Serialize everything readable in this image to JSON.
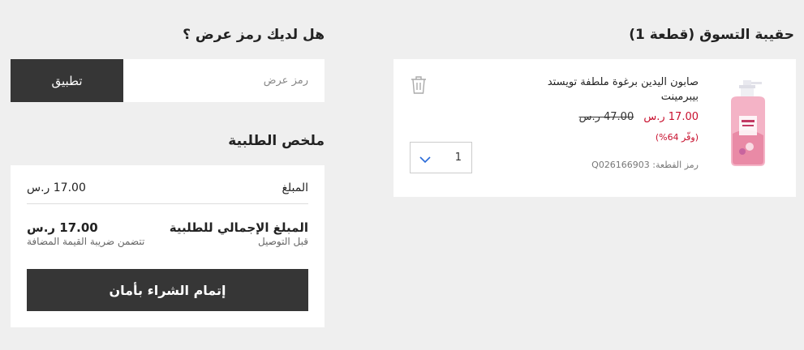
{
  "cart": {
    "title": "حقيبة التسوق (قطعة 1)",
    "item": {
      "name": "صابون اليدين برغوة ملطفة تويستد بيبرمينت",
      "price_new": "17.00 ر.س",
      "price_old": "47.00 ر.س",
      "save": "(وفّر 64%)",
      "sku": "رمز القطعة: Q026166903",
      "quantity": "1",
      "image_icon": "soap-bottle-icon"
    },
    "icons": {
      "remove": "trash-icon",
      "quantity_dropdown": "chevron-down-icon"
    }
  },
  "promo": {
    "title": "هل لديك رمز عرض ؟",
    "placeholder": "رمز عرض",
    "apply_label": "تطبيق"
  },
  "summary": {
    "title": "ملخص الطلبية",
    "amount_label": "المبلغ",
    "amount_value": "17.00 ر.س",
    "total_label": "المبلغ الإجمالي للطلبية",
    "total_value": "17.00 ر.س",
    "before_delivery": "قبل التوصيل",
    "vat_note": "تتضمن ضريبة القيمة المضافة",
    "checkout_label": "إتمام الشراء بأمان"
  },
  "colors": {
    "background": "#efefef",
    "card": "#ffffff",
    "button": "#363636",
    "sale_red": "#c8102e",
    "chevron_blue": "#2a6bd8"
  }
}
